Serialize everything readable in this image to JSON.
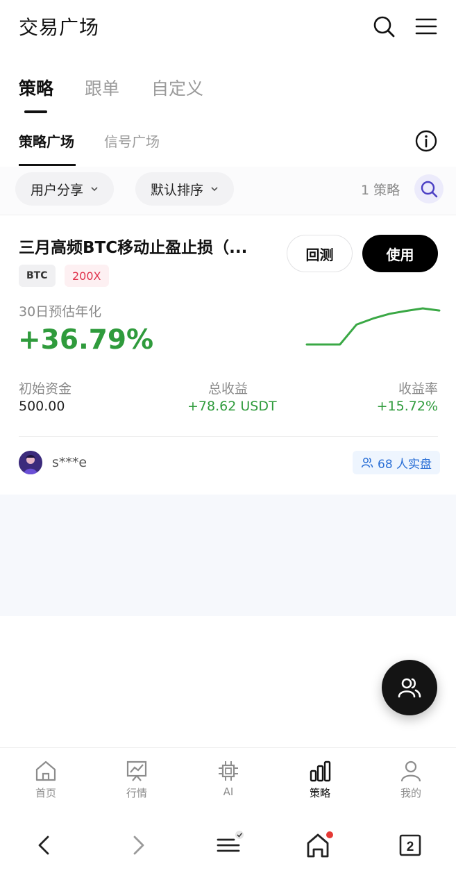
{
  "header": {
    "title": "交易广场",
    "search_icon": "search-icon",
    "menu_icon": "menu-icon"
  },
  "main_tabs": [
    {
      "label": "策略",
      "active": true
    },
    {
      "label": "跟单",
      "active": false
    },
    {
      "label": "自定义",
      "active": false
    }
  ],
  "sub_tabs": [
    {
      "label": "策略广场",
      "active": true
    },
    {
      "label": "信号广场",
      "active": false
    }
  ],
  "filters": {
    "category": "用户分享",
    "sort": "默认排序",
    "count": "1 策略"
  },
  "strategy": {
    "title": "三月高频BTC移动止盈止损（...",
    "tags": [
      "BTC",
      "200X"
    ],
    "backtest_label": "回测",
    "use_label": "使用",
    "apy_label": "30日预估年化",
    "apy_value": "+36.79%",
    "stats": [
      {
        "label": "初始资金",
        "value": "500.00"
      },
      {
        "label": "总收益",
        "value": "+78.62 USDT"
      },
      {
        "label": "收益率",
        "value": "+15.72%"
      }
    ],
    "author": "s***e",
    "live_count": "68 人实盘",
    "spark": [
      0.0,
      0.0,
      0.0,
      0.55,
      0.72,
      0.85,
      0.93,
      1.0,
      0.94
    ]
  },
  "bottom_nav": [
    {
      "label": "首页",
      "icon": "home-icon",
      "active": false
    },
    {
      "label": "行情",
      "icon": "market-chart-icon",
      "active": false
    },
    {
      "label": "AI",
      "icon": "ai-chip-icon",
      "active": false
    },
    {
      "label": "策略",
      "icon": "strategy-bars-icon",
      "active": true
    },
    {
      "label": "我的",
      "icon": "profile-icon",
      "active": false
    }
  ],
  "system_bar": {
    "tab_count": "2"
  },
  "colors": {
    "positive": "#2f9b3c",
    "negative": "#e0314b",
    "link_blue": "#2a6fd6",
    "accent_purple": "#4b3fc4"
  }
}
